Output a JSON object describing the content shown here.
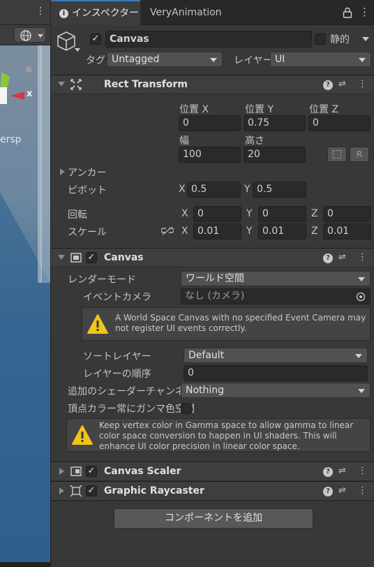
{
  "scene": {
    "persp_label": "ersp",
    "axis_label": "x"
  },
  "tabs": {
    "inspector": "インスペクター",
    "very_animation": "VeryAnimation"
  },
  "gameobject": {
    "name": "Canvas",
    "active": true,
    "static_label": "静的",
    "tag_label": "タグ",
    "tag_value": "Untagged",
    "layer_label": "レイヤー",
    "layer_value": "UI"
  },
  "rect_transform": {
    "title": "Rect Transform",
    "pos_x_label": "位置 X",
    "pos_y_label": "位置 Y",
    "pos_z_label": "位置 Z",
    "pos_x": "0",
    "pos_y": "0.75",
    "pos_z": "0",
    "width_label": "幅",
    "height_label": "高さ",
    "width": "100",
    "height": "20",
    "raw_button": "R",
    "anchor_label": "アンカー",
    "pivot_label": "ピボット",
    "pivot_x_label": "X",
    "pivot_x": "0.5",
    "pivot_y_label": "Y",
    "pivot_y": "0.5",
    "rotation_label": "回転",
    "rot_x": "0",
    "rot_y": "0",
    "rot_z": "0",
    "scale_label": "スケール",
    "scale_x": "0.01",
    "scale_y": "0.01",
    "scale_z": "0.01",
    "x": "X",
    "y": "Y",
    "z": "Z"
  },
  "canvas": {
    "title": "Canvas",
    "enabled": true,
    "render_mode_label": "レンダーモード",
    "render_mode_value": "ワールド空間",
    "event_camera_label": "イベントカメラ",
    "event_camera_value": "なし (カメラ)",
    "warning": "A World Space Canvas with no specified Event Camera may not register UI events correctly.",
    "sorting_layer_label": "ソートレイヤー",
    "sorting_layer_value": "Default",
    "order_label": "レイヤーの順序",
    "order_value": "0",
    "shader_channels_label": "追加のシェーダーチャンネル",
    "shader_channels_value": "Nothing",
    "vertex_gamma_label": "頂点カラー常にガンマ色空間",
    "vertex_gamma_checked": false,
    "info": "Keep vertex color in Gamma space to allow gamma to linear color space conversion to happen in UI shaders. This will enhance UI color precision in linear color space."
  },
  "canvas_scaler": {
    "title": "Canvas Scaler",
    "enabled": true
  },
  "graphic_raycaster": {
    "title": "Graphic Raycaster",
    "enabled": true
  },
  "add_component_label": "コンポーネントを追加",
  "colors": {
    "background": "#383838",
    "field": "#2a2a2a",
    "accent": "#3a79bb",
    "warning": "#f0c419"
  }
}
